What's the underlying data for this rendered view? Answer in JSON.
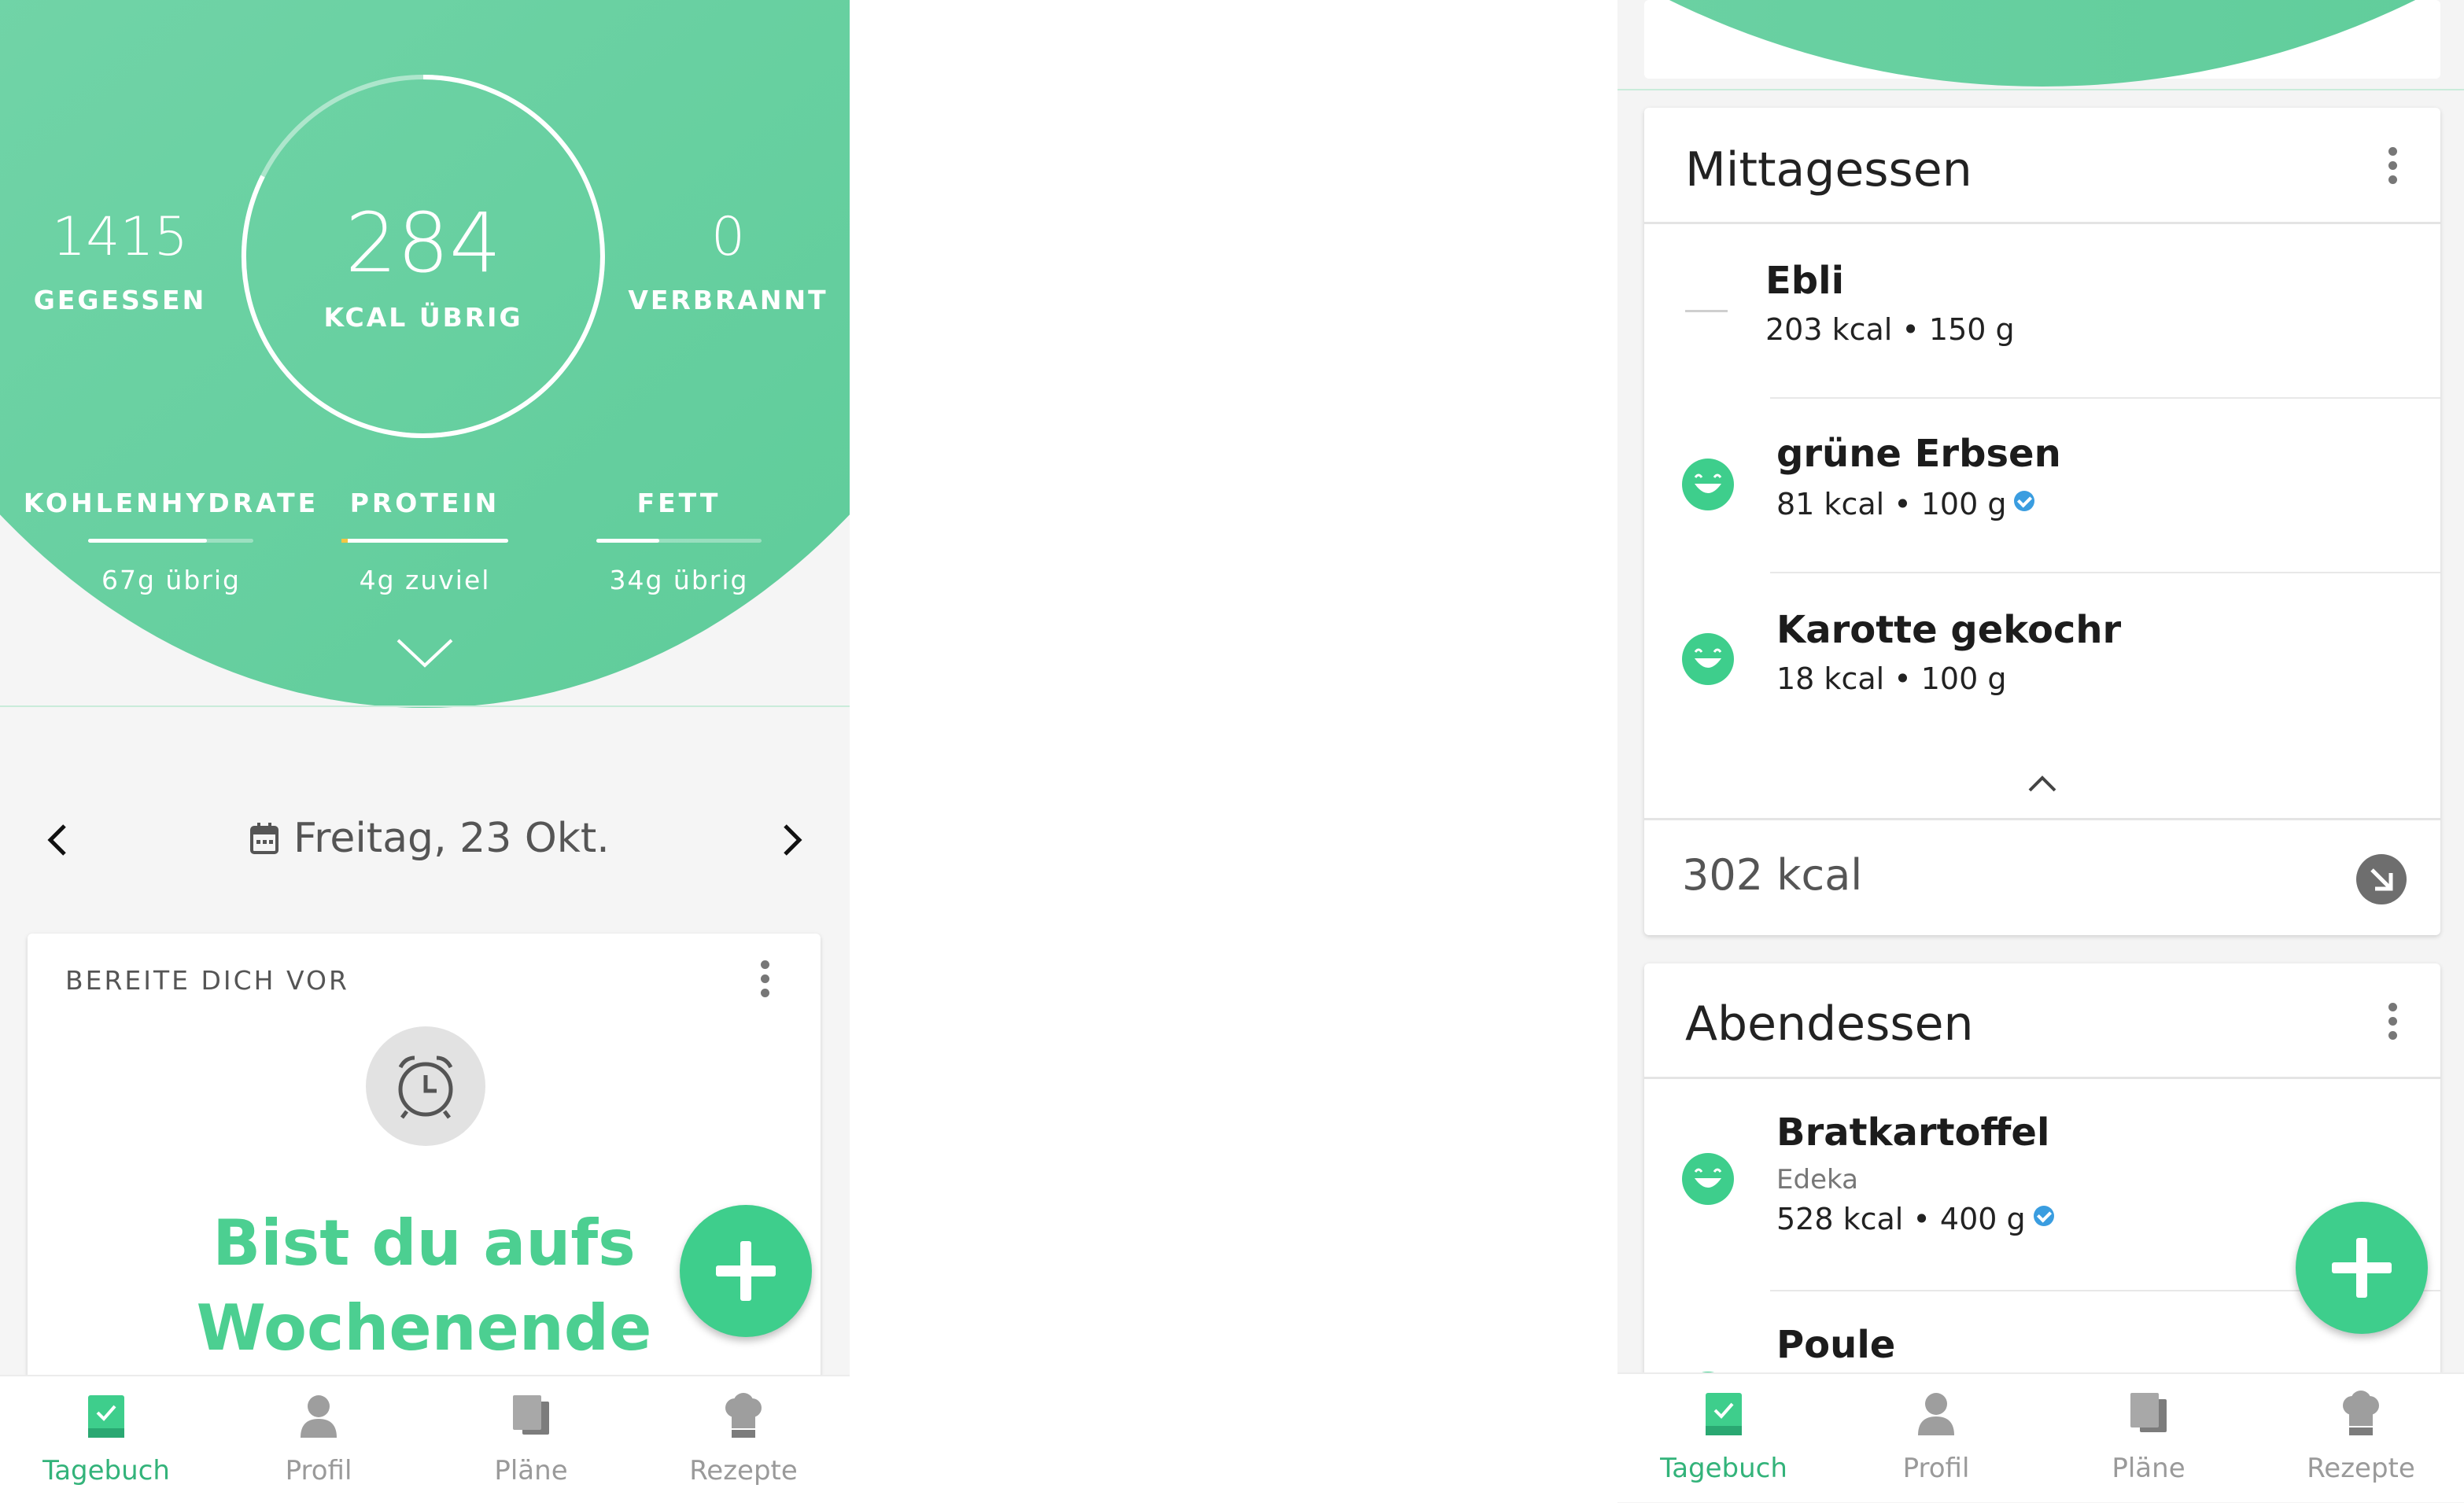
{
  "left": {
    "summary": {
      "eaten_value": "1415",
      "eaten_label": "GEGESSEN",
      "remaining_value": "284",
      "remaining_label": "KCAL ÜBRIG",
      "burned_value": "0",
      "burned_label": "VERBRANNT"
    },
    "macros": [
      {
        "label": "KOHLENHYDRATE",
        "sub": "67g übrig",
        "progress": 0.72
      },
      {
        "label": "PROTEIN",
        "sub": "4g zuviel",
        "progress": 1.0
      },
      {
        "label": "FETT",
        "sub": "34g übrig",
        "progress": 0.38
      }
    ],
    "date_label": "Freitag, 23 Okt.",
    "card": {
      "kicker": "BEREITE DICH VOR",
      "headline_line1": "Bist du aufs",
      "headline_line2": "Wochenende"
    }
  },
  "right": {
    "lunch": {
      "title": "Mittagessen",
      "items": [
        {
          "name": "Ebli",
          "sub": "203 kcal • 150 g",
          "icon": "dash-icon",
          "verified": false
        },
        {
          "name": "grüne Erbsen",
          "sub": "81 kcal • 100 g",
          "icon": "smiley-icon",
          "verified": true
        },
        {
          "name": "Karotte gekochr",
          "sub": "18 kcal • 100 g",
          "icon": "smiley-icon",
          "verified": false
        }
      ],
      "total": "302 kcal"
    },
    "dinner": {
      "title": "Abendessen",
      "items": [
        {
          "name": "Bratkartoffel",
          "brand": "Edeka",
          "sub": "528 kcal • 400 g",
          "icon": "smiley-icon",
          "verified": true
        },
        {
          "name": "Poule"
        }
      ]
    }
  },
  "nav": {
    "items": [
      "Tagebuch",
      "Profil",
      "Pläne",
      "Rezepte"
    ],
    "active": "Tagebuch"
  },
  "colors": {
    "accent": "#3ece8c",
    "header_green": "#6fd3a6",
    "verified_blue": "#3a9de0"
  }
}
